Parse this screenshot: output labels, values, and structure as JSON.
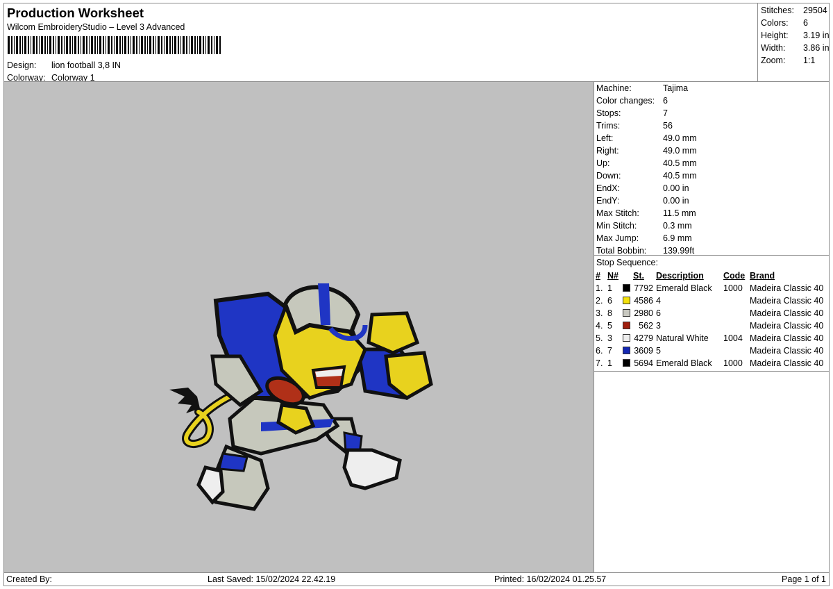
{
  "header": {
    "title": "Production Worksheet",
    "software": "Wilcom EmbroideryStudio – Level 3 Advanced",
    "design_label": "Design:",
    "design_value": "lion football 3,8 IN",
    "colorway_label": "Colorway:",
    "colorway_value": "Colorway 1"
  },
  "summary": [
    {
      "label": "Stitches:",
      "value": "29504"
    },
    {
      "label": "Colors:",
      "value": "6"
    },
    {
      "label": "Height:",
      "value": "3.19 in"
    },
    {
      "label": "Width:",
      "value": "3.86 in"
    },
    {
      "label": "Zoom:",
      "value": "1:1"
    }
  ],
  "details": [
    {
      "label": "Machine:",
      "value": "Tajima"
    },
    {
      "label": "Color changes:",
      "value": "6"
    },
    {
      "label": "Stops:",
      "value": "7"
    },
    {
      "label": "Trims:",
      "value": "56"
    },
    {
      "label": "Left:",
      "value": "49.0 mm"
    },
    {
      "label": "Right:",
      "value": "49.0 mm"
    },
    {
      "label": "Up:",
      "value": "40.5 mm"
    },
    {
      "label": "Down:",
      "value": "40.5 mm"
    },
    {
      "label": "EndX:",
      "value": "0.00 in"
    },
    {
      "label": "EndY:",
      "value": "0.00 in"
    },
    {
      "label": "Max Stitch:",
      "value": "11.5 mm"
    },
    {
      "label": "Min Stitch:",
      "value": "0.3 mm"
    },
    {
      "label": "Max Jump:",
      "value": "6.9 mm"
    },
    {
      "label": "Total Bobbin:",
      "value": "139.99ft"
    }
  ],
  "stop_sequence": {
    "title": "Stop Sequence:",
    "columns": {
      "num": "#",
      "n": "N#",
      "st": "St.",
      "description": "Description",
      "code": "Code",
      "brand": "Brand"
    },
    "rows": [
      {
        "num": "1.",
        "n": "1",
        "color": "#000000",
        "st": "7792",
        "description": "Emerald Black",
        "code": "1000",
        "brand": "Madeira Classic 40"
      },
      {
        "num": "2.",
        "n": "6",
        "color": "#f4e20c",
        "st": "4586",
        "description": "4",
        "code": "",
        "brand": "Madeira Classic 40"
      },
      {
        "num": "3.",
        "n": "8",
        "color": "#c8c8c0",
        "st": "2980",
        "description": "6",
        "code": "",
        "brand": "Madeira Classic 40"
      },
      {
        "num": "4.",
        "n": "5",
        "color": "#a01e0e",
        "st": "562",
        "description": "3",
        "code": "",
        "brand": "Madeira Classic 40"
      },
      {
        "num": "5.",
        "n": "3",
        "color": "#eeeeee",
        "st": "4279",
        "description": "Natural White",
        "code": "1004",
        "brand": "Madeira Classic 40"
      },
      {
        "num": "6.",
        "n": "7",
        "color": "#1428b4",
        "st": "3609",
        "description": "5",
        "code": "",
        "brand": "Madeira Classic 40"
      },
      {
        "num": "7.",
        "n": "1",
        "color": "#000000",
        "st": "5694",
        "description": "Emerald Black",
        "code": "1000",
        "brand": "Madeira Classic 40"
      }
    ]
  },
  "footer": {
    "created_by": "Created By:",
    "last_saved": "Last Saved: 15/02/2024 22.42.19",
    "printed": "Printed: 16/02/2024 01.25.57",
    "page": "Page 1 of 1"
  },
  "preview": {
    "background": "#c0c0c0",
    "colors": {
      "outline": "#111111",
      "yellow": "#e8d21e",
      "blue": "#1f35c4",
      "gray": "#c6c8bc",
      "white": "#eeeeee",
      "red": "#b03018"
    }
  }
}
